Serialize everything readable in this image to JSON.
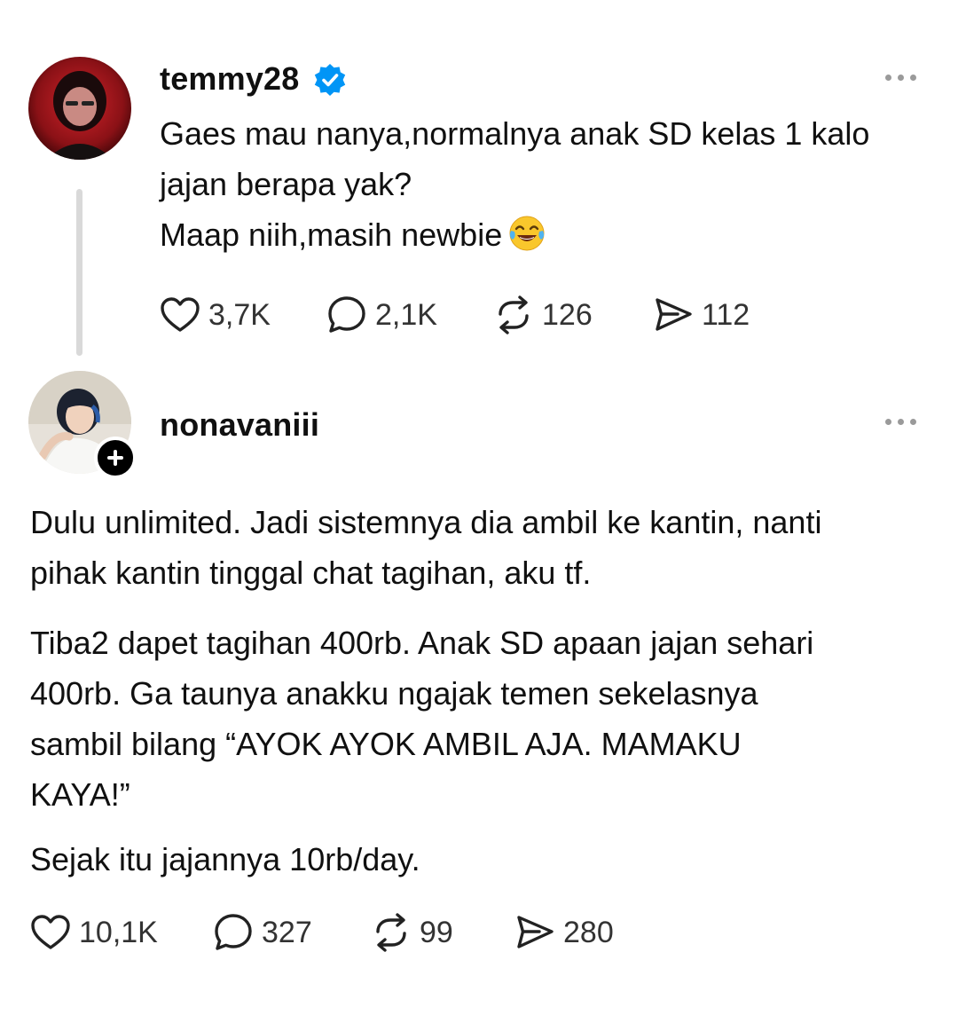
{
  "posts": [
    {
      "username": "temmy28",
      "verified": true,
      "avatar_icon": "avatar-photo",
      "body_lines": [
        "Gaes mau nanya,normalnya anak SD kelas 1 kalo",
        "jajan berapa yak?",
        "Maap niih,masih newbie"
      ],
      "emoji": "face-with-tears-of-joy",
      "stats": {
        "likes": "3,7K",
        "replies": "2,1K",
        "reposts": "126",
        "shares": "112"
      }
    },
    {
      "username": "nonavaniii",
      "verified": false,
      "avatar_icon": "avatar-photo",
      "follow_icon": "plus-icon",
      "paragraphs": [
        [
          "Dulu unlimited. Jadi sistemnya dia ambil ke kantin, nanti",
          "pihak kantin tinggal chat tagihan, aku tf."
        ],
        [
          "Tiba2 dapet tagihan 400rb. Anak SD apaan jajan sehari",
          "400rb. Ga taunya anakku ngajak temen sekelasnya",
          "sambil bilang “AYOK AYOK AMBIL AJA. MAMAKU",
          "KAYA!”"
        ],
        [
          "Sejak itu jajannya 10rb/day."
        ]
      ],
      "stats": {
        "likes": "10,1K",
        "replies": "327",
        "reposts": "99",
        "shares": "280"
      }
    }
  ],
  "colors": {
    "verified_badge": "#0095f6",
    "text": "#101010",
    "secondary_text": "#333333",
    "icon_muted": "#9a9a9a",
    "thread_line": "#d9d9d9"
  },
  "icons": {
    "like": "heart-icon",
    "reply": "comment-icon",
    "repost": "repost-icon",
    "share": "send-icon",
    "more": "more-options-icon"
  }
}
